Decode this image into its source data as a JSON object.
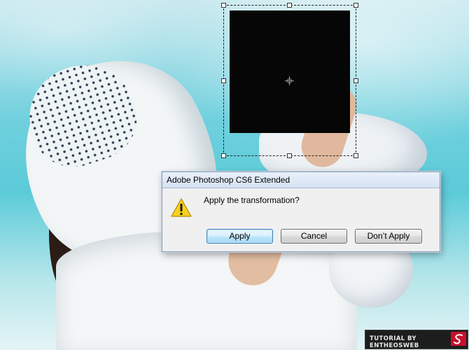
{
  "dialog": {
    "title": "Adobe Photoshop CS6 Extended",
    "message": "Apply the transformation?",
    "buttons": {
      "apply": "Apply",
      "cancel": "Cancel",
      "dont_apply": "Don’t Apply"
    },
    "icon": "warning-icon"
  },
  "watermark": {
    "text": "TUTORIAL BY ENTHEOSWEB",
    "logo": "entheosweb-logo"
  },
  "colors": {
    "selection_fill": "#060606",
    "default_button_border": "#3c7fb1",
    "warning_yellow": "#f7d21e"
  }
}
